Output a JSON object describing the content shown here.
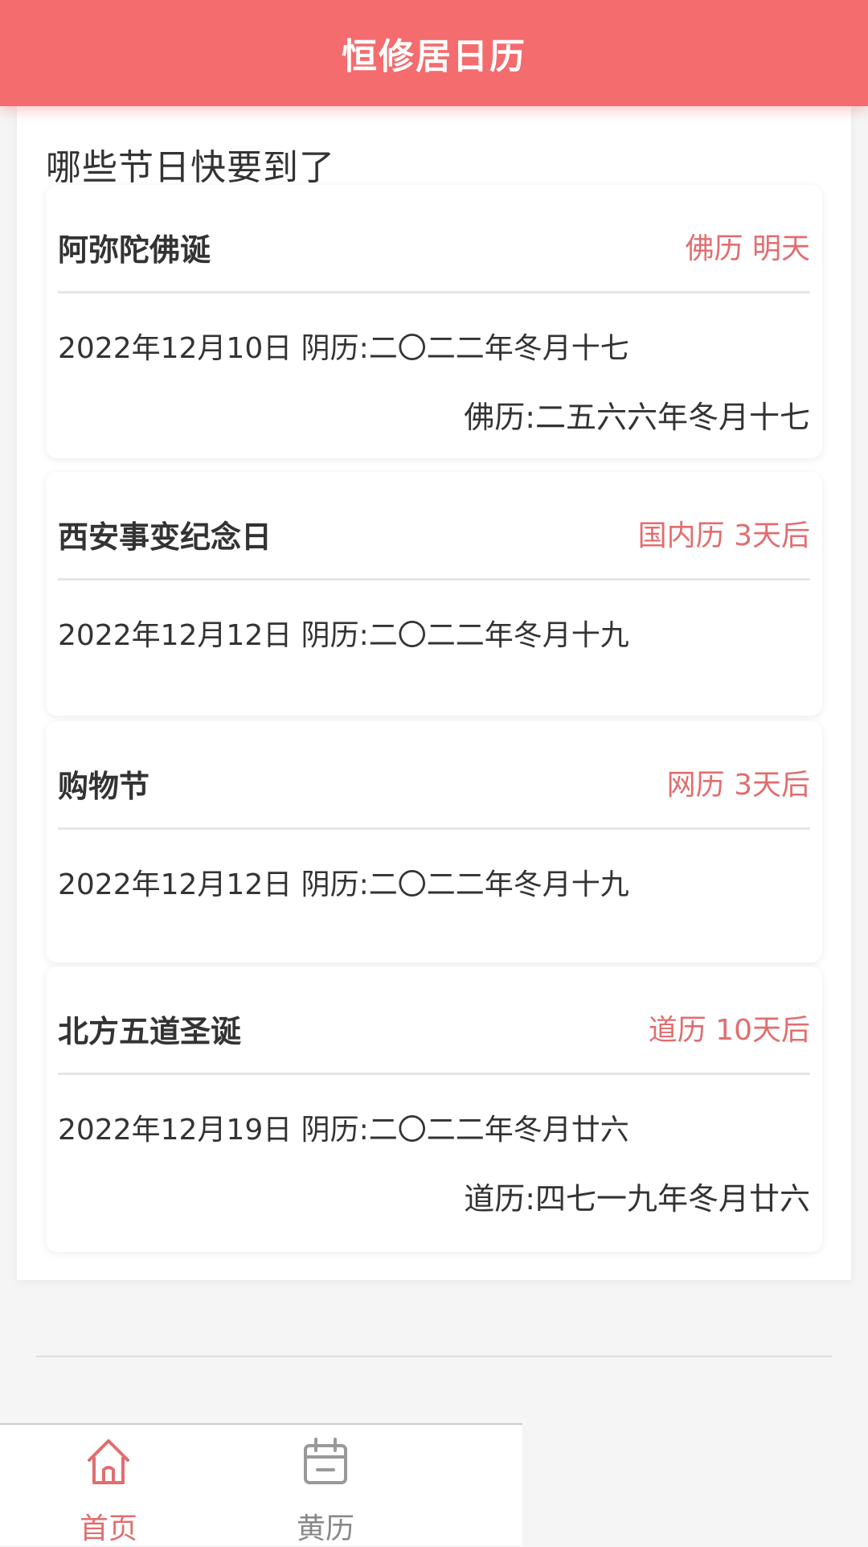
{
  "header": {
    "title": "恒修居日历"
  },
  "section": {
    "title": "哪些节日快要到了"
  },
  "festivals": [
    {
      "name": "阿弥陀佛诞",
      "tag": "佛历 明天",
      "date_line": "2022年12月10日 阴历:二〇二二年冬月十七",
      "extra_line": "佛历:二五六六年冬月十七"
    },
    {
      "name": "西安事变纪念日",
      "tag": "国内历 3天后",
      "date_line": "2022年12月12日 阴历:二〇二二年冬月十九",
      "extra_line": ""
    },
    {
      "name": "购物节",
      "tag": "网历 3天后",
      "date_line": "2022年12月12日 阴历:二〇二二年冬月十九",
      "extra_line": ""
    },
    {
      "name": "北方五道圣诞",
      "tag": "道历 10天后",
      "date_line": "2022年12月19日 阴历:二〇二二年冬月廿六",
      "extra_line": "道历:四七一九年冬月廿六"
    }
  ],
  "tabbar": {
    "items": [
      {
        "label": "首页",
        "icon": "home-icon",
        "active": true
      },
      {
        "label": "黄历",
        "icon": "calendar-icon",
        "active": false
      }
    ]
  },
  "colors": {
    "accent": "#f46c6e",
    "tag_text": "#e26d6f"
  }
}
